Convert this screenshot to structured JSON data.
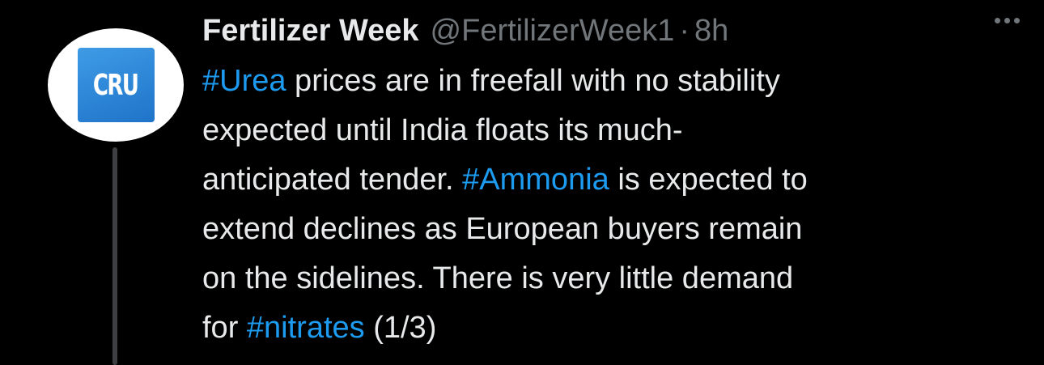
{
  "avatar": {
    "logo_text": "CRU",
    "logo_color": "#2a84d8"
  },
  "author": {
    "name": "Fertilizer Week",
    "handle": "@FertilizerWeek1",
    "separator": "·",
    "time": "8h"
  },
  "menu": {
    "icon": "more-horizontal-icon"
  },
  "tweet": {
    "line1_tag": "#Urea",
    "line1_text": " prices are in freefall with no stability",
    "line2_text": "expected until India floats its much-",
    "line3_text": "anticipated tender. ",
    "line3_tag": "#Ammonia",
    "line3_text_after": " is expected to",
    "line4_text": "extend declines as European buyers remain",
    "line5_text": "on the sidelines. There is very little demand",
    "line6_text": "for ",
    "line6_tag": "#nitrates",
    "line6_text_after": " (1/3)"
  },
  "colors": {
    "background": "#000000",
    "text": "#e7e9ea",
    "muted": "#71767b",
    "link": "#1d9bf0",
    "thread_line": "#3d3f42"
  }
}
